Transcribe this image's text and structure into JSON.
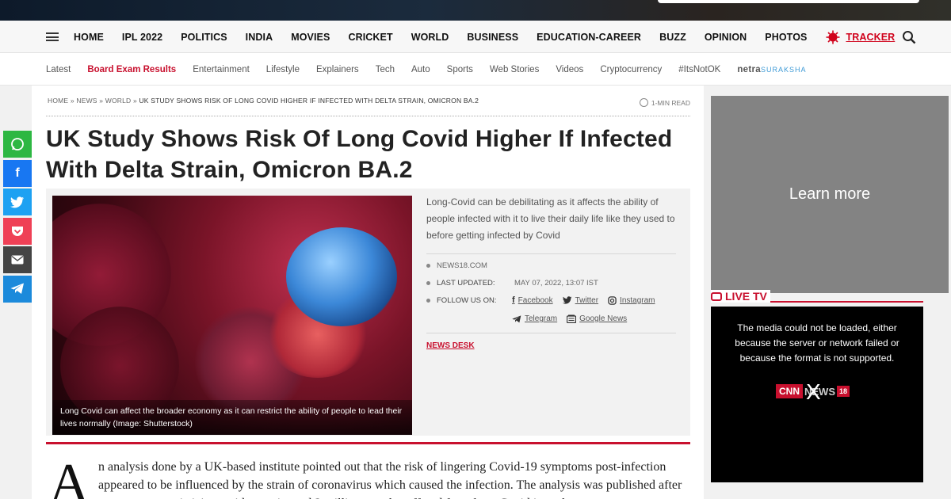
{
  "mainnav": {
    "items": [
      "HOME",
      "IPL 2022",
      "POLITICS",
      "INDIA",
      "MOVIES",
      "CRICKET",
      "WORLD",
      "BUSINESS",
      "EDUCATION-CAREER",
      "BUZZ",
      "OPINION",
      "PHOTOS"
    ],
    "tracker": "TRACKER"
  },
  "subnav": {
    "items": [
      "Latest",
      "Board Exam Results",
      "Entertainment",
      "Lifestyle",
      "Explainers",
      "Tech",
      "Auto",
      "Sports",
      "Web Stories",
      "Videos",
      "Cryptocurrency",
      "#ItsNotOK"
    ],
    "netra_a": "netra",
    "netra_b": "SURAKSHA"
  },
  "social": [
    "whatsapp-icon",
    "facebook-icon",
    "twitter-icon",
    "pocket-icon",
    "email-icon",
    "telegram-icon"
  ],
  "breadcrumb": {
    "home": "HOME",
    "news": "NEWS",
    "world": "WORLD",
    "current": "UK STUDY SHOWS RISK OF LONG COVID HIGHER IF INFECTED WITH DELTA STRAIN, OMICRON BA.2",
    "sep": "»"
  },
  "read_time": "1-MIN READ",
  "article": {
    "title": "UK Study Shows Risk Of Long Covid Higher If Infected With Delta Strain, Omicron BA.2",
    "caption": "Long Covid can affect the broader economy as it can restrict the ability of people to lead their lives normally (Image: Shutterstock)",
    "description": "Long-Covid can be debilitating as it affects the ability of people infected with it to live their daily life like they used to before getting infected by Covid",
    "source": "NEWS18.COM",
    "last_updated_label": "LAST UPDATED:",
    "last_updated_value": "MAY 07, 2022, 13:07 IST",
    "follow_label": "FOLLOW US ON:",
    "follow": {
      "facebook": "Facebook",
      "twitter": "Twitter",
      "instagram": "Instagram",
      "telegram": "Telegram",
      "google_news": "Google News"
    },
    "author": "NEWS DESK",
    "dropcap": "A",
    "body": "n analysis done by a UK-based institute pointed out that the risk of lingering Covid-19 symptoms post-infection appeared to be influenced by the strain of coronavirus which caused the infection. The analysis was published after government statisticians said an estimated 2 million people suffered from long Covid in early"
  },
  "ad": {
    "label": "Learn more"
  },
  "live_tv": {
    "heading": "LIVE TV",
    "error": "The media could not be loaded, either because the server or network failed or because the format is not supported.",
    "logo_a": "CNN",
    "logo_b": "NEWS",
    "logo_c": "18",
    "close": "X"
  },
  "colors": {
    "accent": "#c8102e",
    "whatsapp": "#2db742",
    "facebook": "#1877f2",
    "twitter": "#1da1f2",
    "pocket": "#ef4056",
    "telegram": "#1c8adb"
  }
}
